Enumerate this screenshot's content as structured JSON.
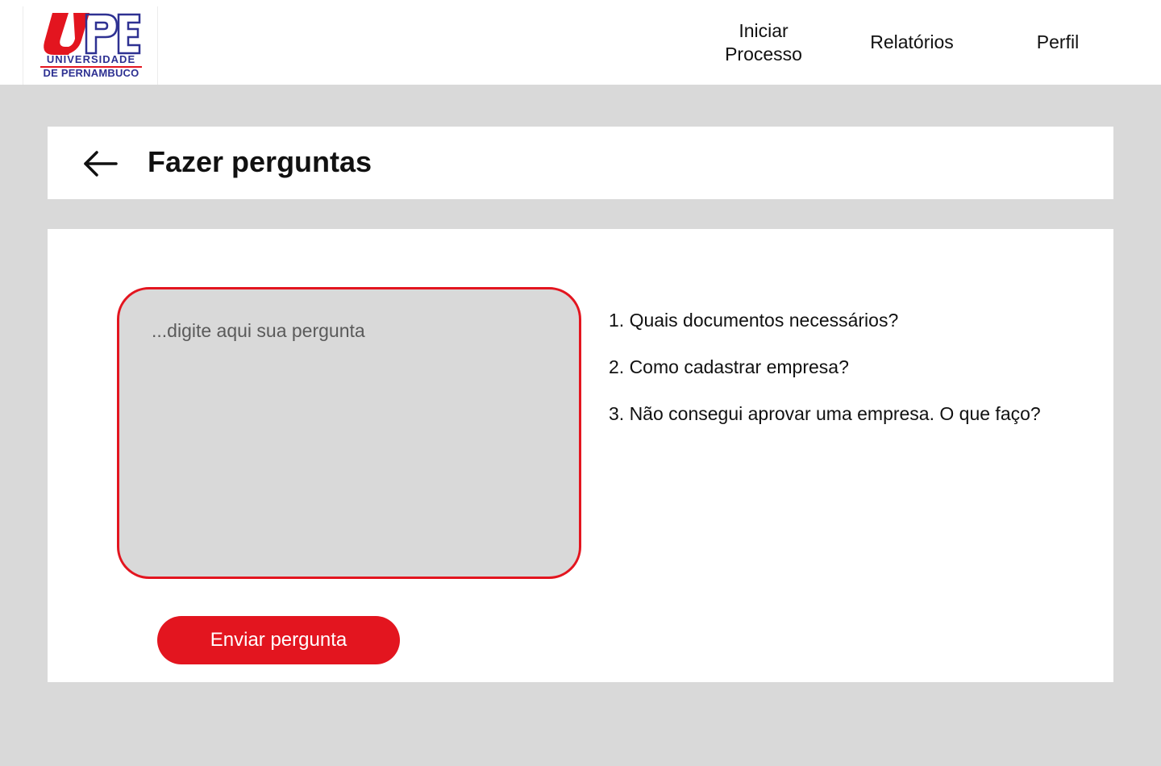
{
  "brand": {
    "line1": "UNIVERSIDADE",
    "line2": "DE PERNAMBUCO",
    "colors": {
      "red": "#e3151f",
      "blue": "#2e3192"
    }
  },
  "nav": {
    "start_process_line1": "Iniciar",
    "start_process_line2": "Processo",
    "reports": "Relatórios",
    "profile": "Perfil"
  },
  "page": {
    "title": "Fazer perguntas",
    "back_icon": "arrow-left-icon"
  },
  "form": {
    "question_placeholder": "...digite aqui sua pergunta",
    "question_value": "",
    "submit_label": "Enviar pergunta"
  },
  "faq": {
    "items": [
      "1. Quais documentos necessários?",
      "2. Como cadastrar empresa?",
      "3. Não consegui aprovar uma empresa. O que faço?"
    ]
  },
  "colors": {
    "accent": "#e3151f",
    "background": "#d9d9d9",
    "card": "#ffffff"
  }
}
